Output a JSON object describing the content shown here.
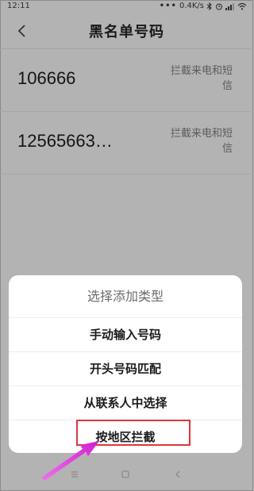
{
  "status_bar": {
    "time": "12:11",
    "dots": "•••",
    "speed": "0.4K/s",
    "icons": [
      "bluetooth-icon",
      "alarm-icon",
      "signal-icon",
      "wifi-icon"
    ]
  },
  "header": {
    "title": "黑名单号码"
  },
  "blacklist": {
    "items": [
      {
        "number": "106666",
        "desc": "拦截来电和短信"
      },
      {
        "number": "12565663…",
        "desc": "拦截来电和短信"
      }
    ]
  },
  "sheet": {
    "title": "选择添加类型",
    "options": [
      "手动输入号码",
      "开头号码匹配",
      "从联系人中选择",
      "按地区拦截"
    ]
  },
  "annotation": {
    "highlight_color": "#e0343a",
    "arrow_color": "#e040e0"
  },
  "nav": {
    "icons": [
      "menu-icon",
      "home-icon",
      "back-nav-icon"
    ]
  }
}
